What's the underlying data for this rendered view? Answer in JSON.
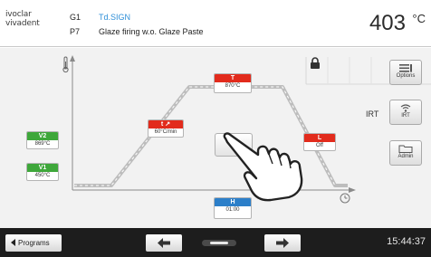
{
  "header": {
    "brand_line1": "ivoclar",
    "brand_line2": "vivadent",
    "program_group": "G1",
    "program_number": "P7",
    "program_tag": "Td.SIGN",
    "program_name": "Glaze firing w.o. Glaze Paste",
    "temperature": "403",
    "temperature_unit": "°C"
  },
  "firing_curve": {
    "thermometer_icon": "thermometer-icon",
    "clock_icon": "clock-icon",
    "params": {
      "V2": {
        "label": "V2",
        "value": "869°C",
        "color": "#3ea73a"
      },
      "V1": {
        "label": "V1",
        "value": "450°C",
        "color": "#3ea73a"
      },
      "t": {
        "label": "t ↗",
        "value": "60°C/min",
        "color": "#e22b1c"
      },
      "T": {
        "label": "T",
        "value": "870°C",
        "color": "#e22b1c"
      },
      "L": {
        "label": "L",
        "value": "Off",
        "color": "#e22b1c"
      },
      "H": {
        "label": "H",
        "value": "01:00",
        "color": "#2c7fc9"
      }
    }
  },
  "side_panel": {
    "lock_icon": "lock-icon",
    "options_label": "Options",
    "irt_title": "IRT",
    "irt_button_label": "IRT",
    "admin_label": "Admin"
  },
  "bottom_bar": {
    "programs_label": "Programs",
    "time": "15:44:37"
  }
}
